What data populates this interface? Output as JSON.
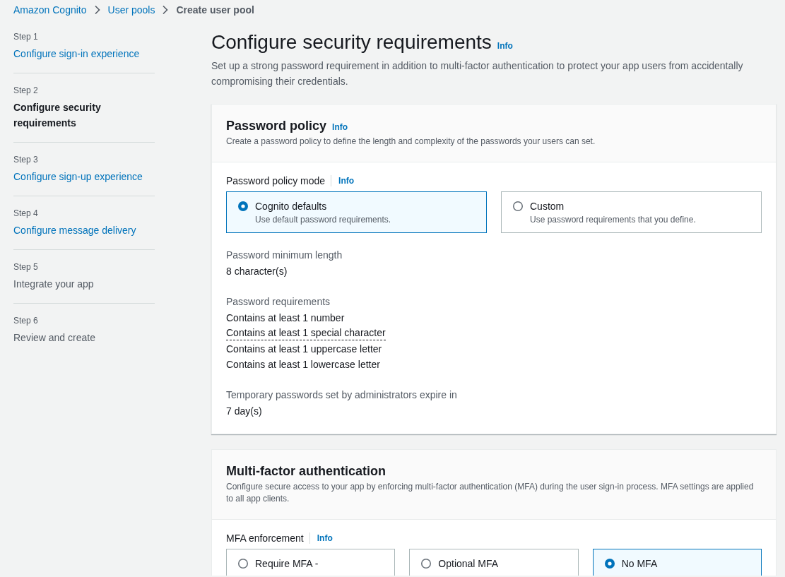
{
  "breadcrumbs": [
    {
      "label": "Amazon Cognito",
      "kind": "link"
    },
    {
      "label": "User pools",
      "kind": "link"
    },
    {
      "label": "Create user pool",
      "kind": "current"
    }
  ],
  "steps": [
    {
      "step": "Step 1",
      "title": "Configure sign-in experience",
      "selected": false,
      "disabled": false
    },
    {
      "step": "Step 2",
      "title": "Configure security requirements",
      "selected": true,
      "disabled": false
    },
    {
      "step": "Step 3",
      "title": "Configure sign-up experience",
      "selected": false,
      "disabled": false
    },
    {
      "step": "Step 4",
      "title": "Configure message delivery",
      "selected": false,
      "disabled": false
    },
    {
      "step": "Step 5",
      "title": "Integrate your app",
      "selected": false,
      "disabled": true
    },
    {
      "step": "Step 6",
      "title": "Review and create",
      "selected": false,
      "disabled": true
    }
  ],
  "page": {
    "title": "Configure security requirements",
    "info": "Info",
    "description": "Set up a strong password requirement in addition to multi-factor authentication to protect your app users from accidentally compromising their credentials."
  },
  "password_policy": {
    "title": "Password policy",
    "info": "Info",
    "description": "Create a password policy to define the length and complexity of the passwords your users can set.",
    "mode": {
      "label": "Password policy mode",
      "info": "Info",
      "options": [
        {
          "label": "Cognito defaults",
          "description": "Use default password requirements.",
          "selected": true
        },
        {
          "label": "Custom",
          "description": "Use password requirements that you define.",
          "selected": false
        }
      ]
    },
    "settings": [
      {
        "label": "Password minimum length",
        "values": [
          {
            "text": "8 character(s)",
            "popover": false
          }
        ]
      },
      {
        "label": "Password requirements",
        "values": [
          {
            "text": "Contains at least 1 number",
            "popover": false
          },
          {
            "text": "Contains at least 1 special character",
            "popover": true
          },
          {
            "text": "Contains at least 1 uppercase letter",
            "popover": false
          },
          {
            "text": "Contains at least 1 lowercase letter",
            "popover": false
          }
        ]
      },
      {
        "label": "Temporary passwords set by administrators expire in",
        "values": [
          {
            "text": "7 day(s)",
            "popover": false
          }
        ]
      }
    ]
  },
  "mfa": {
    "title": "Multi-factor authentication",
    "description": "Configure secure access to your app by enforcing multi-factor authentication (MFA) during the user sign-in process. MFA settings are applied to all app clients.",
    "enforcement": {
      "label": "MFA enforcement",
      "info": "Info",
      "options": [
        {
          "label": "Require MFA -",
          "selected": false
        },
        {
          "label": "Optional MFA",
          "selected": false
        },
        {
          "label": "No MFA",
          "selected": true
        }
      ]
    }
  }
}
